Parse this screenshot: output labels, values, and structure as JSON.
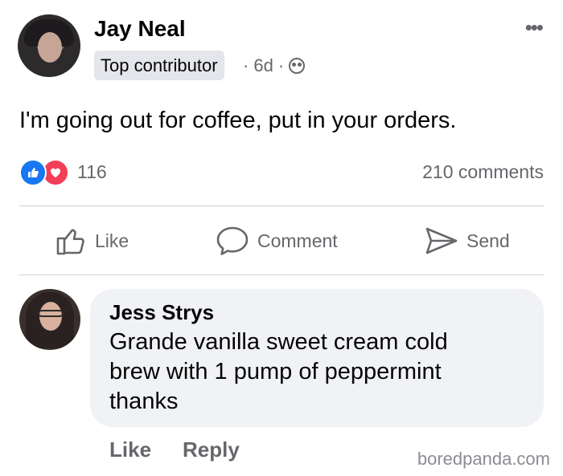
{
  "post": {
    "author": "Jay Neal",
    "badge": "Top contributor",
    "time": "6d",
    "separator": "·",
    "text": "I'm going out for coffee, put in your orders.",
    "more_icon": "more-horizontal-icon",
    "group_icon": "group-icon"
  },
  "stats": {
    "reaction_count": "116",
    "comments": "210 comments",
    "reactions": [
      "like",
      "love"
    ]
  },
  "actions": {
    "like": "Like",
    "comment": "Comment",
    "send": "Send"
  },
  "comment": {
    "author": "Jess Strys",
    "lines": [
      "Grande vanilla sweet cream cold",
      "brew with 1 pump of peppermint",
      "thanks"
    ],
    "actions": {
      "like": "Like",
      "reply": "Reply"
    }
  },
  "watermark": "boredpanda.com",
  "colors": {
    "facebook_blue": "#1877f2",
    "love_red": "#f33e58",
    "secondary_text": "#65676b",
    "bubble_bg": "#f0f2f5"
  }
}
